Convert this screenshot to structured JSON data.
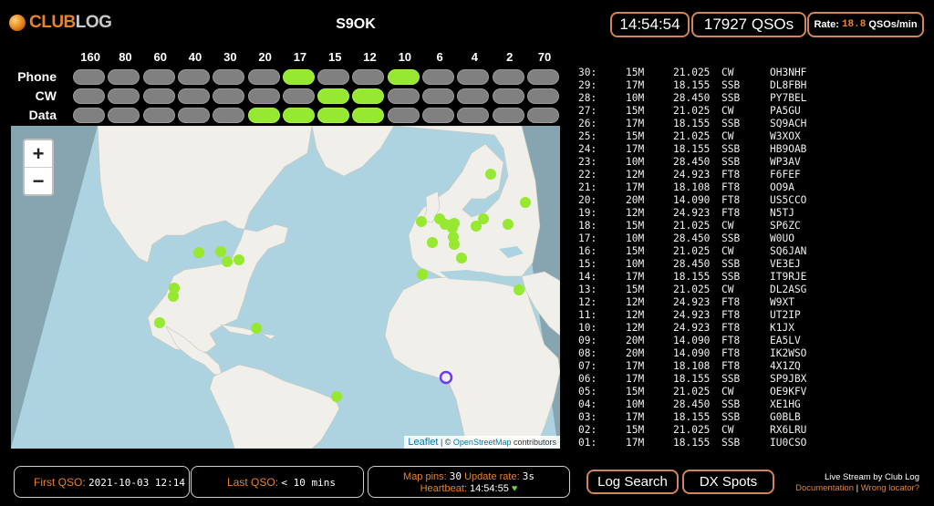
{
  "header": {
    "logo_club": "CLUB",
    "logo_log": "LOG",
    "callsign": "S9OK",
    "clock": "14:54:54",
    "qsos": "17927 QSOs",
    "rate_label": "Rate:",
    "rate_value": "18.8",
    "rate_unit": "QSOs/min"
  },
  "bands": [
    "160",
    "80",
    "60",
    "40",
    "30",
    "20",
    "17",
    "15",
    "12",
    "10",
    "6",
    "4",
    "2",
    "70"
  ],
  "modes": [
    {
      "label": "Phone",
      "active": [
        6,
        9
      ]
    },
    {
      "label": "CW",
      "active": [
        7,
        8
      ]
    },
    {
      "label": "Data",
      "active": [
        5,
        6,
        7,
        8
      ]
    }
  ],
  "colors": {
    "accent": "#e8832a",
    "active_band": "#96e830",
    "inactive_band": "#808080",
    "box_border": "#d0855a"
  },
  "map": {
    "zoom_in": "+",
    "zoom_out": "−",
    "attr_leaflet": "Leaflet",
    "attr_sep": " | © ",
    "attr_osm": "OpenStreetMap",
    "attr_contrib": " contributors"
  },
  "qsos": [
    {
      "n": "30:",
      "band": "15M",
      "freq": "21.025",
      "mode": "CW",
      "call": "OH3NHF"
    },
    {
      "n": "29:",
      "band": "17M",
      "freq": "18.155",
      "mode": "SSB",
      "call": "DL8FBH"
    },
    {
      "n": "28:",
      "band": "10M",
      "freq": "28.450",
      "mode": "SSB",
      "call": "PY7BEL"
    },
    {
      "n": "27:",
      "band": "15M",
      "freq": "21.025",
      "mode": "CW",
      "call": "PA5GU"
    },
    {
      "n": "26:",
      "band": "17M",
      "freq": "18.155",
      "mode": "SSB",
      "call": "SQ9ACH"
    },
    {
      "n": "25:",
      "band": "15M",
      "freq": "21.025",
      "mode": "CW",
      "call": "W3XOX"
    },
    {
      "n": "24:",
      "band": "17M",
      "freq": "18.155",
      "mode": "SSB",
      "call": "HB9OAB"
    },
    {
      "n": "23:",
      "band": "10M",
      "freq": "28.450",
      "mode": "SSB",
      "call": "WP3AV"
    },
    {
      "n": "22:",
      "band": "12M",
      "freq": "24.923",
      "mode": "FT8",
      "call": "F6FEF"
    },
    {
      "n": "21:",
      "band": "17M",
      "freq": "18.108",
      "mode": "FT8",
      "call": "OO9A"
    },
    {
      "n": "20:",
      "band": "20M",
      "freq": "14.090",
      "mode": "FT8",
      "call": "US5CCO"
    },
    {
      "n": "19:",
      "band": "12M",
      "freq": "24.923",
      "mode": "FT8",
      "call": "N5TJ"
    },
    {
      "n": "18:",
      "band": "15M",
      "freq": "21.025",
      "mode": "CW",
      "call": "SP6ZC"
    },
    {
      "n": "17:",
      "band": "10M",
      "freq": "28.450",
      "mode": "SSB",
      "call": "W0UO"
    },
    {
      "n": "16:",
      "band": "15M",
      "freq": "21.025",
      "mode": "CW",
      "call": "SQ6JAN"
    },
    {
      "n": "15:",
      "band": "10M",
      "freq": "28.450",
      "mode": "SSB",
      "call": "VE3EJ"
    },
    {
      "n": "14:",
      "band": "17M",
      "freq": "18.155",
      "mode": "SSB",
      "call": "IT9RJE"
    },
    {
      "n": "13:",
      "band": "15M",
      "freq": "21.025",
      "mode": "CW",
      "call": "DL2ASG"
    },
    {
      "n": "12:",
      "band": "12M",
      "freq": "24.923",
      "mode": "FT8",
      "call": "W9XT"
    },
    {
      "n": "11:",
      "band": "12M",
      "freq": "24.923",
      "mode": "FT8",
      "call": "UT2IP"
    },
    {
      "n": "10:",
      "band": "12M",
      "freq": "24.923",
      "mode": "FT8",
      "call": "K1JX"
    },
    {
      "n": "09:",
      "band": "20M",
      "freq": "14.090",
      "mode": "FT8",
      "call": "EA5LV"
    },
    {
      "n": "08:",
      "band": "20M",
      "freq": "14.090",
      "mode": "FT8",
      "call": "IK2WSO"
    },
    {
      "n": "07:",
      "band": "17M",
      "freq": "18.108",
      "mode": "FT8",
      "call": "4X1ZQ"
    },
    {
      "n": "06:",
      "band": "17M",
      "freq": "18.155",
      "mode": "SSB",
      "call": "SP9JBX"
    },
    {
      "n": "05:",
      "band": "15M",
      "freq": "21.025",
      "mode": "CW",
      "call": "OE9KFV"
    },
    {
      "n": "04:",
      "band": "10M",
      "freq": "28.450",
      "mode": "SSB",
      "call": "XE1HG"
    },
    {
      "n": "03:",
      "band": "17M",
      "freq": "18.155",
      "mode": "SSB",
      "call": "G0BLB"
    },
    {
      "n": "02:",
      "band": "15M",
      "freq": "21.025",
      "mode": "CW",
      "call": "RX6LRU"
    },
    {
      "n": "01:",
      "band": "17M",
      "freq": "18.155",
      "mode": "SSB",
      "call": "IU0CSO"
    }
  ],
  "footer": {
    "first_qso_label": "First QSO:",
    "first_qso_value": "2021-10-03 12:14",
    "last_qso_label": "Last QSO:",
    "last_qso_value": "< 10 mins",
    "map_pins_label": "Map pins:",
    "map_pins_value": "30",
    "update_rate_label": "Update rate:",
    "update_rate_value": "3s",
    "heartbeat_label": "Heartbeat:",
    "heartbeat_value": "14:54:55",
    "heart": "♥",
    "log_search": "Log Search",
    "dx_spots": "DX Spots",
    "credit": "Live Stream by Club Log",
    "documentation": "Documentation",
    "sep": " | ",
    "wrong_locator": "Wrong locator?"
  }
}
